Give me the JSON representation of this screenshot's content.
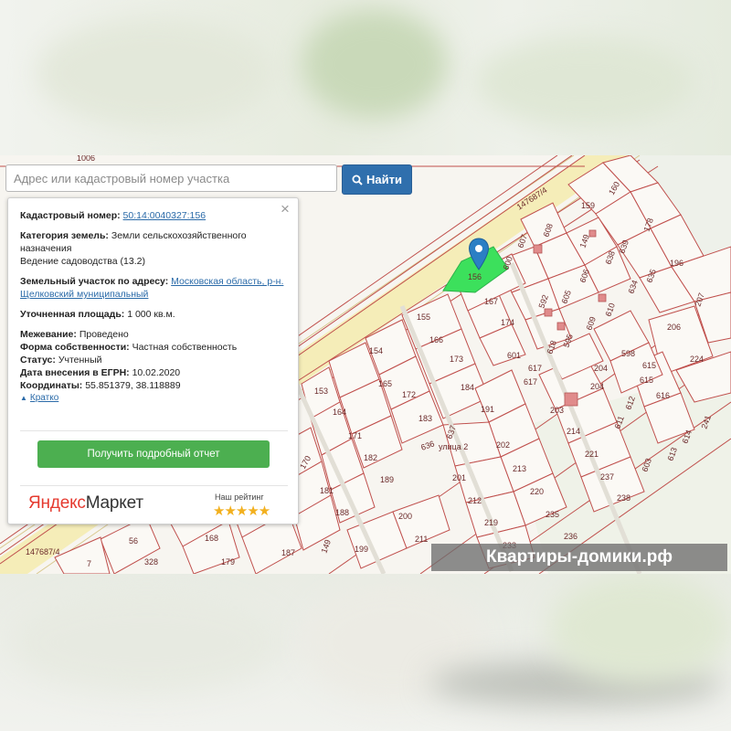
{
  "search": {
    "placeholder": "Адрес или кадастровый номер участка",
    "button_label": "Найти"
  },
  "card": {
    "close": "×",
    "cadastral_label": "Кадастровый номер:",
    "cadastral_value": "50:14:0040327:156",
    "category_label": "Категория земель:",
    "category_value": "Земли сельскохозяйственного назначения",
    "usage_value": "Ведение садоводства (13.2)",
    "address_label": "Земельный участок по адресу:",
    "address_value": "Московская область, р-н. Щелковский муниципальный",
    "area_label": "Уточненная площадь:",
    "area_value": "1 000 кв.м.",
    "survey_label": "Межевание:",
    "survey_value": "Проведено",
    "ownership_label": "Форма собственности:",
    "ownership_value": "Частная собственность",
    "status_label": "Статус:",
    "status_value": "Учтенный",
    "egrn_label": "Дата внесения в ЕГРН:",
    "egrn_value": "10.02.2020",
    "coords_label": "Координаты:",
    "coords_value": "55.851379, 38.118889",
    "toggle_label": "Кратко",
    "report_button": "Получить подробный отчет",
    "ym_logo_y": "Яндекс",
    "ym_logo_m": "Маркет",
    "rating_label": "Наш рейтинг",
    "stars": "★★★★★",
    "stars_value": 5
  },
  "map": {
    "parcel_labels": {
      "a1006": "1006",
      "a147687_top": "147687/4",
      "a147687_left": "147687/4",
      "street": "улица 2",
      "p155": "155",
      "p156": "156",
      "p167": "167",
      "p600": "600",
      "p607": "607",
      "p608": "608",
      "p159": "159",
      "p160": "160",
      "p149": "149",
      "p178": "178",
      "p639": "639",
      "p638": "638",
      "p635": "635",
      "p634": "634",
      "p196": "196",
      "p207": "207",
      "p606": "606",
      "p605": "605",
      "p610": "610",
      "p609": "609",
      "p592": "592",
      "p595": "595",
      "p174": "174",
      "p166": "166",
      "p154": "154",
      "p153": "153",
      "p165": "165",
      "p173": "173",
      "p601": "601",
      "p618": "618",
      "p617a": "617",
      "p617b": "617",
      "p206": "206",
      "p224": "224",
      "p598": "598",
      "p615a": "615",
      "p615b": "615",
      "p204a": "204",
      "p204b": "204",
      "p616": "616",
      "p612": "612",
      "p611": "611",
      "p203": "203",
      "p214": "214",
      "p221": "221",
      "p237": "237",
      "p238": "238",
      "p603": "603",
      "p613": "613",
      "p614": "614",
      "p241": "241",
      "p172": "172",
      "p184": "184",
      "p191": "191",
      "p183": "183",
      "p636": "636",
      "p637": "637",
      "p202": "202",
      "p164": "164",
      "p171": "171",
      "p182": "182",
      "p189": "189",
      "p170": "170",
      "p181": "181",
      "p188": "188",
      "p201": "201",
      "p212": "212",
      "p213": "213",
      "p220": "220",
      "p219": "219",
      "p235": "235",
      "p200": "200",
      "p236": "236",
      "p233": "233",
      "p211": "211",
      "p199": "199",
      "p187": "187",
      "p179": "179",
      "p168": "168",
      "p149b": "149",
      "p56": "56",
      "p328": "328",
      "p7": "7"
    }
  },
  "watermark": "Квартиры-домики.рф",
  "colors": {
    "selected_parcel": "#3ce05c",
    "parcel_border": "#c0504d",
    "road": "#f4ecb6",
    "button_blue": "#2f6fad",
    "report_green": "#4caf50",
    "marker_blue": "#2b7fc4"
  }
}
